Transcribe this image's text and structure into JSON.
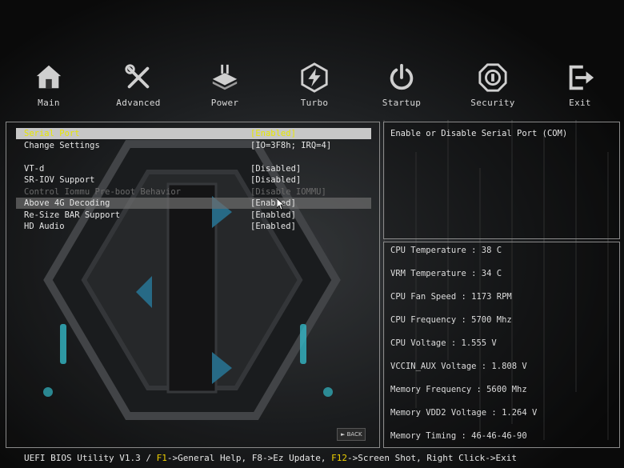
{
  "nav": [
    {
      "label": "Main",
      "icon": "home-icon"
    },
    {
      "label": "Advanced",
      "icon": "tools-icon"
    },
    {
      "label": "Power",
      "icon": "power-chip-icon"
    },
    {
      "label": "Turbo",
      "icon": "lightning-icon"
    },
    {
      "label": "Startup",
      "icon": "power-button-icon"
    },
    {
      "label": "Security",
      "icon": "shield-icon"
    },
    {
      "label": "Exit",
      "icon": "exit-icon"
    }
  ],
  "settings": [
    {
      "label": "Serial Port",
      "value": "[Enabled]"
    },
    {
      "label": "Change Settings",
      "value": "[IO=3F8h; IRQ=4]"
    },
    {
      "label": "VT-d",
      "value": "[Disabled]"
    },
    {
      "label": "SR-IOV Support",
      "value": "[Disabled]"
    },
    {
      "label": "Control Iommu Pre-boot Behavior",
      "value": "[Disable IOMMU]"
    },
    {
      "label": "Above 4G Decoding",
      "value": "[Enabled]"
    },
    {
      "label": "Re-Size BAR Support",
      "value": "[Enabled]"
    },
    {
      "label": "HD Audio",
      "value": "[Enabled]"
    }
  ],
  "help": {
    "text": "Enable or Disable Serial Port (COM)"
  },
  "hardware": [
    "CPU Temperature : 38 C",
    "VRM Temperature : 34 C",
    "CPU Fan Speed : 1173 RPM",
    "CPU Frequency : 5700 Mhz",
    "CPU Voltage : 1.555 V",
    "VCCIN_AUX Voltage : 1.808 V",
    "Memory Frequency : 5600 Mhz",
    "Memory VDD2 Voltage : 1.264 V",
    "Memory Timing : 46-46-46-90"
  ],
  "status": {
    "prefix": "UEFI BIOS Utility V1.3 / ",
    "f1": "F1",
    "help": "->General Help, F8->Ez Update, ",
    "f12": "F12",
    "rest": "->Screen Shot, Right Click->Exit"
  },
  "back_label": "BACK",
  "colors": {
    "accent": "#f0d000",
    "cyan": "#39d5e6"
  }
}
